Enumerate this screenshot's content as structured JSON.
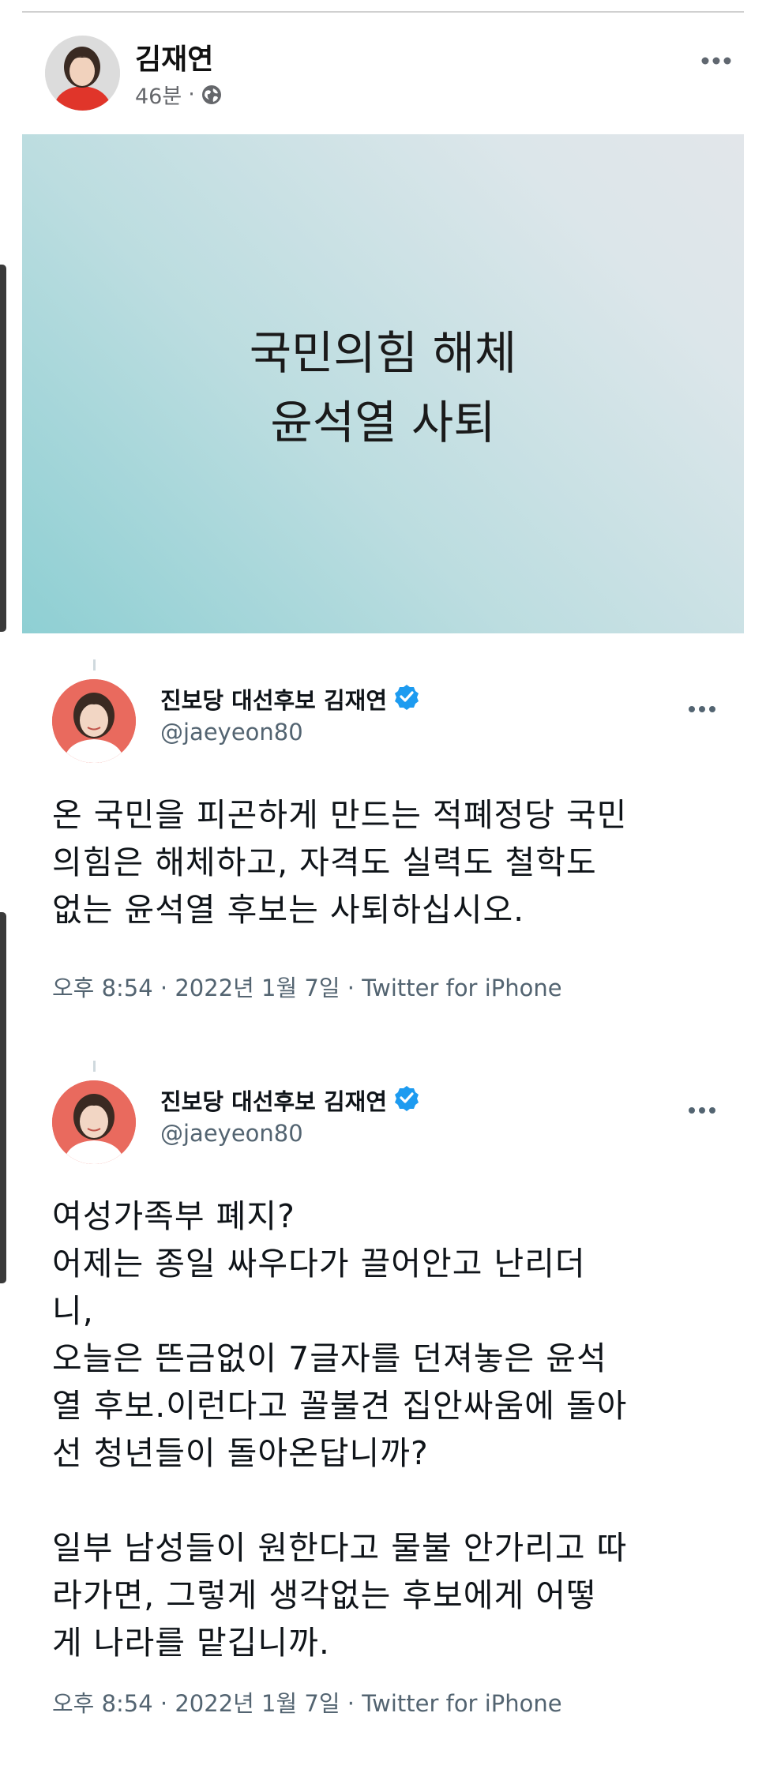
{
  "post": {
    "author": "김재연",
    "time": "46분",
    "separator": "·",
    "image_lines": [
      "국민의힘 해체",
      "윤석열 사퇴"
    ]
  },
  "tweets": [
    {
      "name": "진보당 대선후보 김재연",
      "handle": "@jaeyeon80",
      "text": "온 국민을 피곤하게 만드는 적폐정당 국민\n의힘은 해체하고, 자격도 실력도 철학도\n없는 윤석열 후보는 사퇴하십시오.",
      "footer": "오후 8:54 · 2022년 1월 7일 · Twitter for iPhone"
    },
    {
      "name": "진보당 대선후보 김재연",
      "handle": "@jaeyeon80",
      "text": "여성가족부 폐지?\n어제는 종일 싸우다가 끌어안고 난리더\n니,\n오늘은 뜬금없이 7글자를 던져놓은 윤석\n열 후보.이런다고 꼴불견 집안싸움에 돌아\n선 청년들이 돌아온답니까?\n\n일부 남성들이 원한다고 물불 안가리고 따\n라가면, 그렇게 생각없는 후보에게 어떻\n게 나라를 맡깁니까.",
      "footer": "오후 8:54 · 2022년 1월 7일 · Twitter for iPhone"
    }
  ],
  "colors": {
    "verified": "#1d9bf0",
    "avatar_bg": "#e96a5e",
    "meta_gray": "#65676b"
  },
  "icons": {
    "globe": "globe-icon",
    "more": "more-options-icon",
    "verified": "verified-badge-icon"
  }
}
